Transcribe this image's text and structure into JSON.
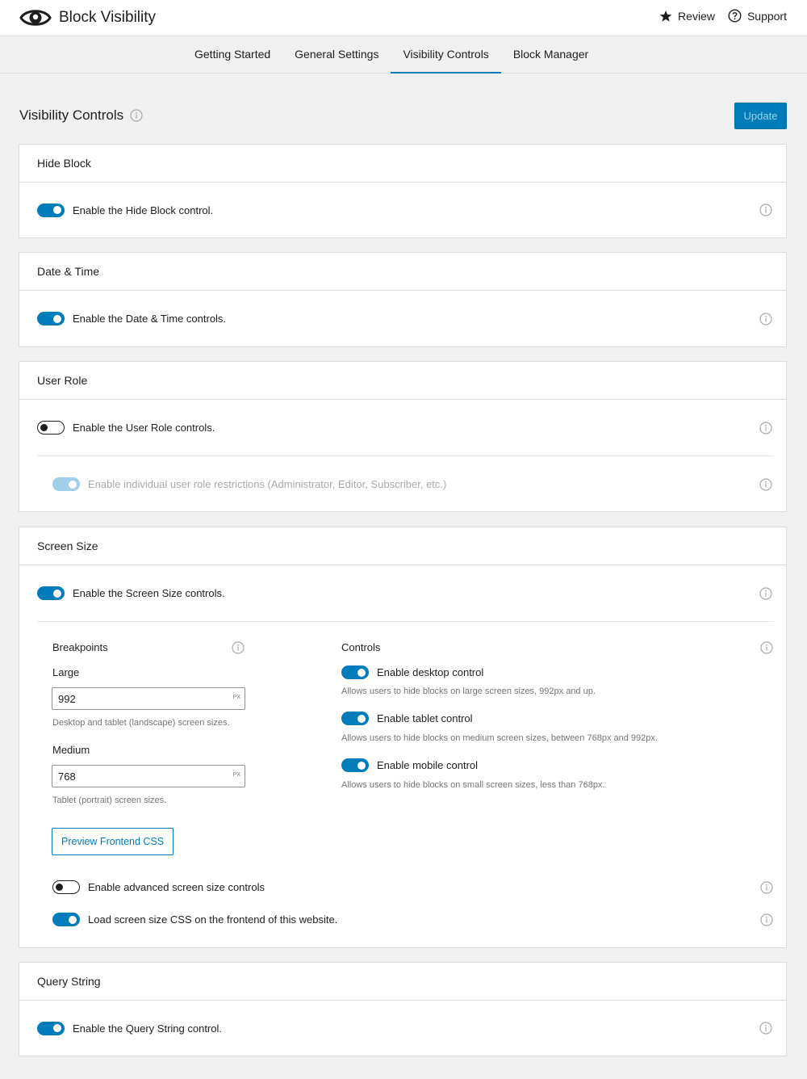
{
  "header": {
    "app_title": "Block Visibility",
    "logo_icon": "eye-icon",
    "links": [
      {
        "label": "Review",
        "icon": "star-icon"
      },
      {
        "label": "Support",
        "icon": "help-circle-icon"
      }
    ]
  },
  "tabs": [
    {
      "label": "Getting Started",
      "active": false
    },
    {
      "label": "General Settings",
      "active": false
    },
    {
      "label": "Visibility Controls",
      "active": true
    },
    {
      "label": "Block Manager",
      "active": false
    }
  ],
  "page": {
    "title": "Visibility Controls",
    "update_label": "Update"
  },
  "colors": {
    "accent": "#007cba",
    "background": "#f0f0f1",
    "border": "#dcdcde",
    "muted_text": "#757575"
  },
  "panels": {
    "hide_block": {
      "title": "Hide Block",
      "toggle_label": "Enable the Hide Block control.",
      "enabled": true
    },
    "date_time": {
      "title": "Date & Time",
      "toggle_label": "Enable the Date & Time controls.",
      "enabled": true
    },
    "user_role": {
      "title": "User Role",
      "toggle_label": "Enable the User Role controls.",
      "enabled": false,
      "sub_toggle_label": "Enable individual user role restrictions (Administrator, Editor, Subscriber, etc.)",
      "sub_enabled": true,
      "sub_disabled": true
    },
    "screen_size": {
      "title": "Screen Size",
      "toggle_label": "Enable the Screen Size controls.",
      "enabled": true,
      "breakpoints": {
        "heading": "Breakpoints",
        "large_label": "Large",
        "large_value": "992",
        "large_unit": "PX",
        "large_help": "Desktop and tablet (landscape) screen sizes.",
        "medium_label": "Medium",
        "medium_value": "768",
        "medium_unit": "PX",
        "medium_help": "Tablet (portrait) screen sizes."
      },
      "controls": {
        "heading": "Controls",
        "items": [
          {
            "label": "Enable desktop control",
            "help": "Allows users to hide blocks on large screen sizes, 992px and up.",
            "enabled": true
          },
          {
            "label": "Enable tablet control",
            "help": "Allows users to hide blocks on medium screen sizes, between 768px and 992px.",
            "enabled": true
          },
          {
            "label": "Enable mobile control",
            "help": "Allows users to hide blocks on small screen sizes, less than 768px.",
            "enabled": true
          }
        ]
      },
      "preview_label": "Preview Frontend CSS",
      "advanced_label": "Enable advanced screen size controls",
      "advanced_enabled": false,
      "load_css_label": "Load screen size CSS on the frontend of this website.",
      "load_css_enabled": true
    },
    "query_string": {
      "title": "Query String",
      "toggle_label": "Enable the Query String control.",
      "enabled": true
    }
  }
}
